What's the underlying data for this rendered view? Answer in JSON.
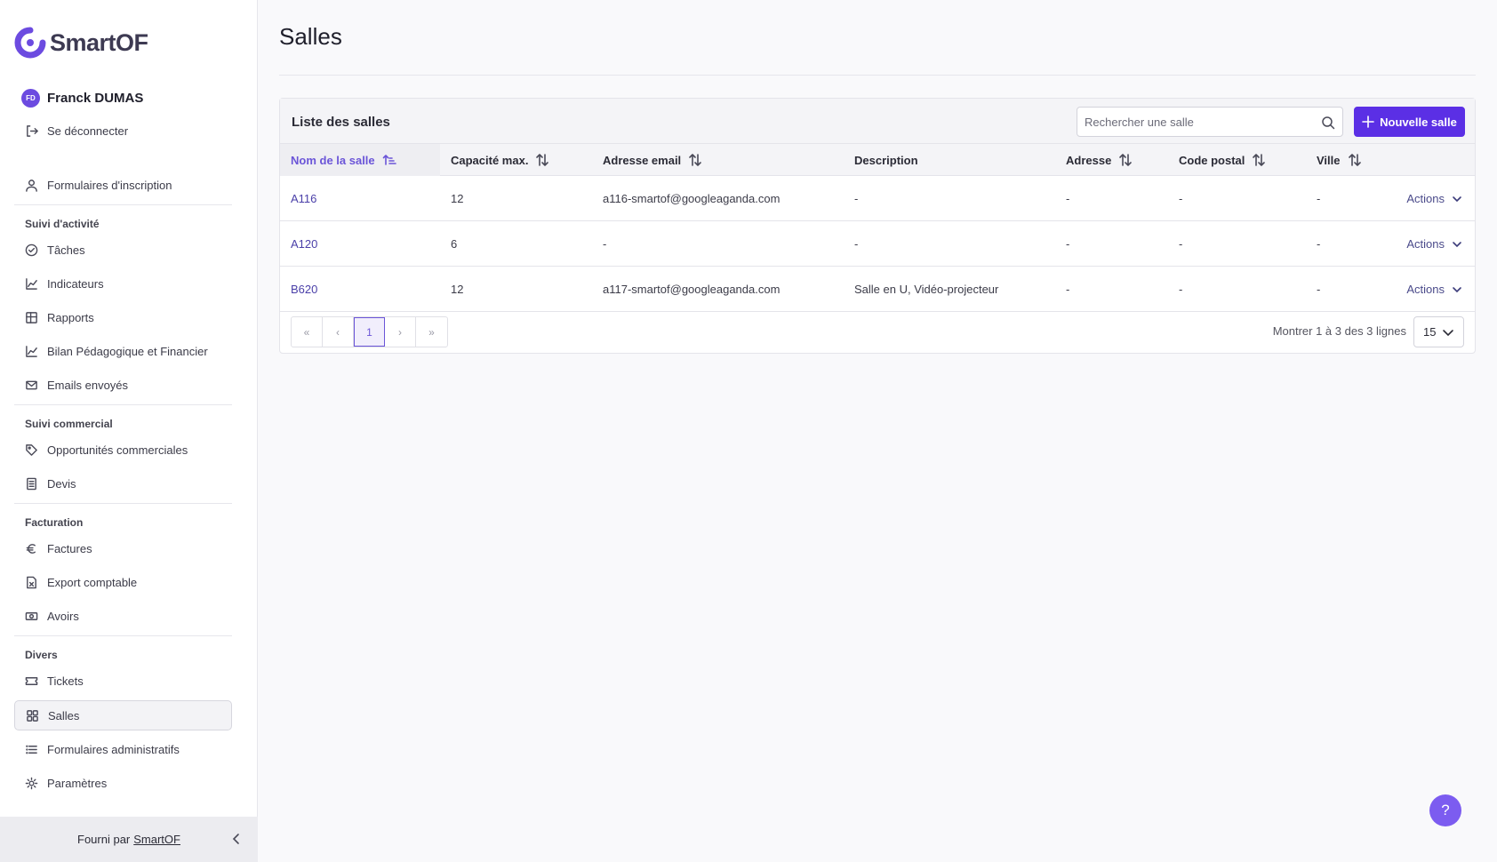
{
  "app": {
    "logo_text": "SmartOF"
  },
  "user": {
    "initials": "FD",
    "name": "Franck DUMAS",
    "logout_label": "Se déconnecter"
  },
  "sidebar": {
    "top_items": [
      {
        "label": "Formulaires d'inscription",
        "icon": "user-icon"
      }
    ],
    "sections": [
      {
        "title": "Suivi d'activité",
        "items": [
          {
            "label": "Tâches",
            "icon": "check-circle-icon"
          },
          {
            "label": "Indicateurs",
            "icon": "chart-line-icon"
          },
          {
            "label": "Rapports",
            "icon": "table-icon"
          },
          {
            "label": "Bilan Pédagogique et Financier",
            "icon": "chart-line-icon"
          },
          {
            "label": "Emails envoyés",
            "icon": "mail-icon"
          }
        ]
      },
      {
        "title": "Suivi commercial",
        "items": [
          {
            "label": "Opportunités commerciales",
            "icon": "tag-icon"
          },
          {
            "label": "Devis",
            "icon": "document-icon"
          }
        ]
      },
      {
        "title": "Facturation",
        "items": [
          {
            "label": "Factures",
            "icon": "euro-icon"
          },
          {
            "label": "Export comptable",
            "icon": "file-export-icon"
          },
          {
            "label": "Avoirs",
            "icon": "banknote-icon"
          }
        ]
      },
      {
        "title": "Divers",
        "items": [
          {
            "label": "Tickets",
            "icon": "ticket-icon"
          },
          {
            "label": "Salles",
            "icon": "grid-icon",
            "active": true
          },
          {
            "label": "Formulaires administratifs",
            "icon": "list-icon"
          },
          {
            "label": "Paramètres",
            "icon": "gear-icon"
          }
        ]
      }
    ],
    "footer": {
      "prefix": "Fourni par",
      "link": "SmartOF"
    }
  },
  "page": {
    "title": "Salles"
  },
  "card": {
    "title": "Liste des salles",
    "search_placeholder": "Rechercher une salle",
    "new_button": "Nouvelle salle"
  },
  "table": {
    "columns": [
      "Nom de la salle",
      "Capacité max.",
      "Adresse email",
      "Description",
      "Adresse",
      "Code postal",
      "Ville"
    ],
    "sorted_column": "Nom de la salle",
    "rows": [
      {
        "name": "A116",
        "capacity": "12",
        "email": "a116-smartof@googleaganda.com",
        "description": "-",
        "address": "-",
        "postal": "-",
        "city": "-",
        "actions": "Actions"
      },
      {
        "name": "A120",
        "capacity": "6",
        "email": "-",
        "description": "-",
        "address": "-",
        "postal": "-",
        "city": "-",
        "actions": "Actions"
      },
      {
        "name": "B620",
        "capacity": "12",
        "email": "a117-smartof@googleaganda.com",
        "description": "Salle en U, Vidéo-projecteur",
        "address": "-",
        "postal": "-",
        "city": "-",
        "actions": "Actions"
      }
    ]
  },
  "pagination": {
    "first": "«",
    "prev": "‹",
    "current_page": "1",
    "next": "›",
    "last": "»",
    "info": "Montrer 1 à 3 des 3 lignes",
    "per_page": "15"
  },
  "help": {
    "label": "?"
  },
  "colors": {
    "accent": "#5b2fe5",
    "avatar": "#6c4be0",
    "help": "#7c5cf0"
  }
}
